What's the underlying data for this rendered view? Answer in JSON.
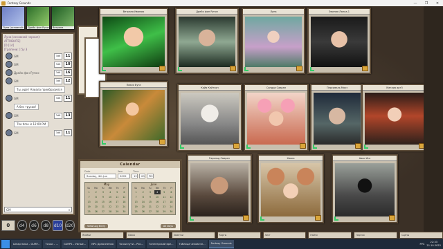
{
  "window": {
    "title": "Fantasy Grounds",
    "controls": [
      "—",
      "❐",
      "✕"
    ]
  },
  "party": [
    {
      "name": "Луна (основной чернил)"
    },
    {
      "name": "Дрейк фон Ругон"
    },
    {
      "name": "Ветрана"
    }
  ],
  "chat": {
    "messages": [
      {
        "type": "sys",
        "text": "Луна (основной чернил):"
      },
      {
        "type": "sys",
        "text": "ATTRIBUTE]"
      },
      {
        "type": "sys",
        "text": "[D [14]"
      },
      {
        "type": "sys",
        "text": "[Трапени: ] 5у 3"
      }
    ],
    "rolls": [
      {
        "label": "GM",
        "dice": "3d6",
        "value": "11"
      },
      {
        "label": "GM",
        "dice": "3d6",
        "value": "10"
      },
      {
        "label": "Дрейк фон Ругон:",
        "dice": "3d6",
        "value": "16"
      },
      {
        "label": "GM",
        "dice": "3d6",
        "value": "12"
      },
      {
        "label": "GM",
        "dice": "3d6",
        "value": "11"
      },
      {
        "label": "GM",
        "dice": "3d6",
        "value": "13"
      },
      {
        "label": "GM",
        "dice": "3d6",
        "value": "11"
      }
    ],
    "bubble_1": "Ты, идет Алиала приобразился",
    "bubble_2": "А без трусов!",
    "time_note": "The time is 12:00 PM",
    "input_value": "GM",
    "input_dropdown": "▾"
  },
  "tray": {
    "modifier": "0",
    "dice": [
      "d4",
      "d6",
      "d8",
      "d10",
      "d20"
    ]
  },
  "cards": [
    {
      "name": "Ветрана Иваною",
      "art": "elfgirl"
    },
    {
      "name": "Дрейк фон Ругон",
      "art": "elfman"
    },
    {
      "name": "Луна",
      "art": "fairy"
    },
    {
      "name": "Эмилия Лапка-1",
      "art": "catwoman"
    },
    {
      "name": "Пикси Буга",
      "art": "greenfairy"
    },
    {
      "name": "Кайя Кейтсон",
      "art": "lynx"
    },
    {
      "name": "Сандра Сааран",
      "art": "pinkmouse"
    },
    {
      "name": "Персиваль Мяуз",
      "art": "sphynx"
    },
    {
      "name": "Матаиа арт3",
      "art": "redhead"
    },
    {
      "name": "Гарольд Свирен",
      "art": "beard"
    },
    {
      "name": "Хиока",
      "art": "mouse"
    },
    {
      "name": "Авис Ися",
      "art": "owl"
    }
  ],
  "calendar": {
    "title": "Calendar",
    "head_labels": [
      "Date",
      "Year",
      "Time"
    ],
    "weekday": "Sunday, 4th Jun",
    "year": "2022",
    "hour": "12",
    "minute": "00",
    "ampm": "PM",
    "months": [
      {
        "name": "May",
        "days_header": [
          "Su",
          "Mo",
          "Tu",
          "We",
          "Th",
          "Fr"
        ],
        "days": [
          "1",
          "2",
          "3",
          "4",
          "5",
          "6",
          "7",
          "8",
          "9",
          "10",
          "11",
          "12",
          "13",
          "14",
          "15",
          "16",
          "17",
          "18",
          "19",
          "20",
          "21",
          "22",
          "23",
          "24",
          "25",
          "26",
          "27",
          "28",
          "29",
          "30"
        ],
        "selected": ""
      },
      {
        "name": "June",
        "days_header": [
          "Su",
          "Mo",
          "Tu",
          "We",
          "Th",
          "Fr"
        ],
        "days": [
          "1",
          "2",
          "3",
          "4",
          "5",
          "6",
          "7",
          "8",
          "9",
          "10",
          "11",
          "12",
          "13",
          "14",
          "15",
          "16",
          "17",
          "18",
          "19",
          "20",
          "21",
          "22",
          "23",
          "24",
          "25",
          "26",
          "27",
          "28",
          "29",
          "30"
        ],
        "selected": "4"
      }
    ],
    "btn_log": "View Log Entry",
    "btn_mode": "All Days"
  },
  "hotbar": [
    "Ячейки",
    "Лавка",
    "Заметки",
    "Карты",
    "Лист",
    "Найти",
    "Партии",
    "Сцены"
  ],
  "taskbar": {
    "tasks": [
      "Шпаргалка – GURP...",
      "Точки – ...",
      "GURPS – Умные...",
      "NPC Дополнения",
      "Точки пути – Рис...",
      "Гинегерский вре...",
      "Таблица человечн...",
      "Fantasy Grounds"
    ],
    "active_index": 7,
    "lang": "РУС",
    "time": "22:33",
    "date": "21.10.2022"
  }
}
